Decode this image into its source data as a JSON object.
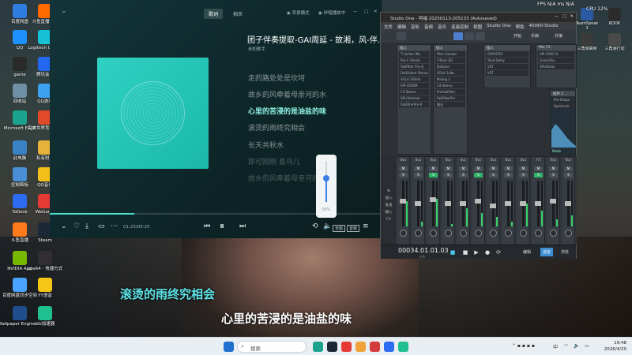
{
  "desktop": {
    "icons": [
      {
        "label": "百度网盘",
        "color": "#2f7de1"
      },
      {
        "label": "斗鱼直播伴侣",
        "color": "#ff6a00"
      },
      {
        "label": "QQ",
        "color": "#1e90ff"
      },
      {
        "label": "Logitech G HUB",
        "color": "#16c1d6"
      },
      {
        "label": "game",
        "color": "#2a2a2a"
      },
      {
        "label": "腾讯会议",
        "color": "#2468f2"
      },
      {
        "label": "回收站",
        "color": "#6f8fa5"
      },
      {
        "label": "QQ游戏",
        "color": "#3ba1f0"
      },
      {
        "label": "Microsoft Edge",
        "color": "#1ba38f"
      },
      {
        "label": "完美世界竞技平台",
        "color": "#e04a2a"
      },
      {
        "label": "此电脑",
        "color": "#3b82c4"
      },
      {
        "label": "私有财产",
        "color": "#e7b23a"
      },
      {
        "label": "控制面板",
        "color": "#4a8fd6"
      },
      {
        "label": "QQ音乐",
        "color": "#f2c019"
      },
      {
        "label": "ToDesk",
        "color": "#2d6cf0"
      },
      {
        "label": "WeGame",
        "color": "#e53935"
      },
      {
        "label": "斗鱼直播",
        "color": "#ff7a1a"
      },
      {
        "label": "Steam",
        "color": "#1b2838"
      },
      {
        "label": "NVIDIA App",
        "color": "#76b900"
      },
      {
        "label": "obs64 - 快捷方式",
        "color": "#302e31"
      },
      {
        "label": "百度网盘同步空间",
        "color": "#4aa3ff"
      },
      {
        "label": "YY语音",
        "color": "#f5c518"
      },
      {
        "label": "Wallpaper Engine:...",
        "color": "#1f4d8c"
      },
      {
        "label": "UU加速器",
        "color": "#1fbf8f"
      }
    ],
    "right_icons": [
      {
        "label": "TeamSpeak 3",
        "color": "#2c5aa0"
      },
      {
        "label": "KOOK",
        "color": "#2b2b2b"
      },
      {
        "label": "三角洲高帧",
        "color": "#3b3b3b"
      },
      {
        "label": "三角洲行动",
        "color": "#4a4a4a"
      }
    ],
    "stats": {
      "fps": "FPS",
      "na1": "N/A",
      "ms": "ms",
      "na2": "N/A",
      "cpu": "CPU",
      "cpu_val": "12",
      "pct": "%"
    }
  },
  "player": {
    "tabs": [
      "歌词",
      "相关"
    ],
    "options": [
      "背景模式",
      "伴唱播放中"
    ],
    "song_title": "团子伴奏提取-GAI周延 - 故湘，风-伴...",
    "artist": "未知歌手",
    "lyrics": [
      "走的路处处是坎坷",
      "故乡的风牵着母亲河的水",
      "心里的苦浸的是油盐的味",
      "滚烫的雨终究相会",
      "长天共秋水",
      "即可刚刚 着乌儿",
      "故乡的风牵着母亲河的水"
    ],
    "current_lyric_index": 2,
    "time": "01:23/05:25",
    "progress": 0.255,
    "volume": 58,
    "volume_label": "58%",
    "right_controls": [
      "无损",
      "音效"
    ],
    "icons": [
      "chevron-down-icon",
      "heart-icon",
      "download-icon",
      "comment-icon",
      "more-icon",
      "prev-icon",
      "pause-icon",
      "next-icon",
      "loop-icon",
      "volume-icon"
    ]
  },
  "studio": {
    "title": "Studio One - 阿福 20250113-205133 (Autosaved)",
    "menu": [
      "文件",
      "编辑",
      "音轨",
      "音频",
      "音乐",
      "连接控制",
      "视图",
      "Studio One",
      "帮助",
      "40060-Studio"
    ],
    "tool_labels": [
      "开始",
      "乐曲",
      "外接"
    ],
    "panes": [
      {
        "header": "插入",
        "slots": [
          "T-Limiter Mic",
          "Pro-C Stereo",
          "FabFilter Pro-Q",
          "DeSibilant Stereo",
          "SOLA 3Sibila",
          "API-3500M",
          "C4 Stereo",
          "SPL/Vitalizer",
          "FabFilterPro-R"
        ]
      },
      {
        "header": "插入",
        "slots": [
          "Pitch Sender",
          "T-Rack EQ",
          "DeEsser",
          "SOLA 3sibs",
          "Mixing 2",
          "C4 Stereo",
          "ProFabFilter",
          "FabFilterPro",
          "输出"
        ]
      },
      {
        "header": "插入",
        "slots": [
          "GRAVITAS",
          "Stud Delay",
          "VST",
          "VST"
        ]
      },
      {
        "header": "Mix FX",
        "slots": [
          "API-2500 St",
          "LinearSky",
          "SPLVitaliz"
        ]
      }
    ],
    "inserts_right": [
      "插件 1",
      "Pro-Shape",
      "Spectrum",
      "Mode"
    ],
    "channel_labels": [
      "Bus",
      "Bus",
      "Bus",
      "Bus",
      "Bus",
      "Bus",
      "Bus",
      "Bus",
      "Bus",
      "FX",
      "Bus",
      "Bus"
    ],
    "strip_names": [
      "伴奏",
      "",
      "人声",
      "",
      "",
      "",
      "FX",
      "Delay",
      "",
      "Bus"
    ],
    "strip_bottom": [
      "新建",
      "组合",
      "人声",
      "编组",
      "",
      "借用(163)",
      "",
      "",
      "Delay",
      "Bus"
    ],
    "timecode": "00034.01.01.03",
    "timecode_sub": "小节",
    "transport_labels": [
      "编辑",
      "混音",
      "浏览"
    ]
  },
  "subtitles": {
    "line1": "滚烫的雨终究相会",
    "line2": "心里的苦浸的是油盐的味"
  },
  "taskbar": {
    "search_placeholder": "搜索",
    "time": "19:48",
    "date": "2026/4/20",
    "ime": "中",
    "sys_icons": [
      "wifi-icon",
      "volume-icon",
      "battery-icon"
    ]
  }
}
